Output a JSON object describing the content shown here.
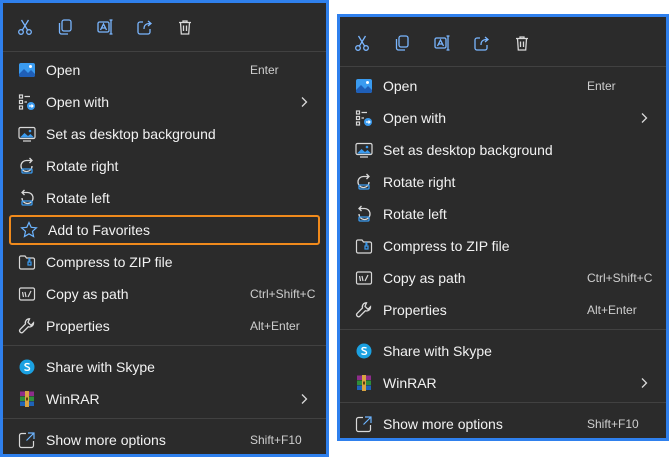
{
  "toolbar": [
    {
      "name": "cut-icon"
    },
    {
      "name": "copy-icon"
    },
    {
      "name": "rename-icon"
    },
    {
      "name": "share-icon"
    },
    {
      "name": "delete-icon"
    }
  ],
  "menuA": {
    "items": [
      {
        "label": "Open",
        "shortcut": "Enter",
        "icon": "photos-icon"
      },
      {
        "label": "Open with",
        "icon": "open-with-icon",
        "submenu": true
      },
      {
        "label": "Set as desktop background",
        "icon": "desktop-background-icon"
      },
      {
        "label": "Rotate right",
        "icon": "rotate-right-icon"
      },
      {
        "label": "Rotate left",
        "icon": "rotate-left-icon"
      },
      {
        "label": "Add to Favorites",
        "icon": "star-icon",
        "highlighted": true
      },
      {
        "label": "Compress to ZIP file",
        "icon": "zip-folder-icon"
      },
      {
        "label": "Copy as path",
        "shortcut": "Ctrl+Shift+C",
        "icon": "copy-path-icon"
      },
      {
        "label": "Properties",
        "shortcut": "Alt+Enter",
        "icon": "wrench-icon"
      },
      {
        "label": "Share with Skype",
        "icon": "skype-icon"
      },
      {
        "label": "WinRAR",
        "icon": "winrar-icon",
        "submenu": true
      },
      {
        "label": "Show more options",
        "shortcut": "Shift+F10",
        "icon": "more-options-icon"
      }
    ]
  },
  "menuB": {
    "items": [
      {
        "label": "Open",
        "shortcut": "Enter",
        "icon": "photos-icon"
      },
      {
        "label": "Open with",
        "icon": "open-with-icon",
        "submenu": true
      },
      {
        "label": "Set as desktop background",
        "icon": "desktop-background-icon"
      },
      {
        "label": "Rotate right",
        "icon": "rotate-right-icon"
      },
      {
        "label": "Rotate left",
        "icon": "rotate-left-icon"
      },
      {
        "label": "Compress to ZIP file",
        "icon": "zip-folder-icon"
      },
      {
        "label": "Copy as path",
        "shortcut": "Ctrl+Shift+C",
        "icon": "copy-path-icon"
      },
      {
        "label": "Properties",
        "shortcut": "Alt+Enter",
        "icon": "wrench-icon"
      },
      {
        "label": "Share with Skype",
        "icon": "skype-icon"
      },
      {
        "label": "WinRAR",
        "icon": "winrar-icon",
        "submenu": true
      },
      {
        "label": "Show more options",
        "shortcut": "Shift+F10",
        "icon": "more-options-icon"
      }
    ]
  },
  "colors": {
    "menu_bg": "#2b2b2b",
    "frame_border": "#2f80ed",
    "highlight_border": "#f08a1c",
    "accent_icon": "#6cb4ff"
  }
}
